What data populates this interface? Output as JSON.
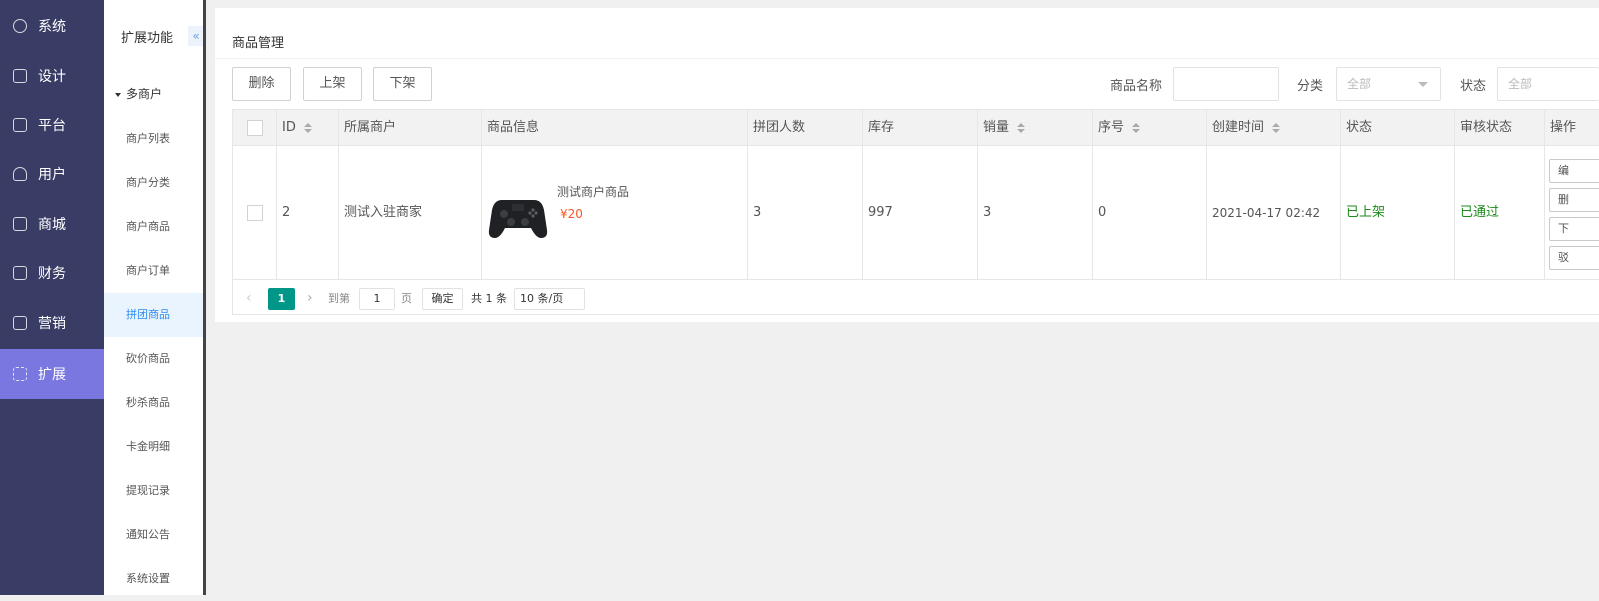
{
  "sidebar_main": {
    "items": [
      {
        "label": "系统",
        "icon": "gear-icon"
      },
      {
        "label": "设计",
        "icon": "design-icon"
      },
      {
        "label": "平台",
        "icon": "platform-icon"
      },
      {
        "label": "用户",
        "icon": "user-icon"
      },
      {
        "label": "商城",
        "icon": "shop-icon"
      },
      {
        "label": "财务",
        "icon": "finance-icon"
      },
      {
        "label": "营销",
        "icon": "gift-icon"
      },
      {
        "label": "扩展",
        "icon": "grid-icon",
        "active": true
      }
    ]
  },
  "sidebar_sub": {
    "title": "扩展功能",
    "collapse_icon": "«",
    "group": "多商户",
    "items": [
      {
        "label": "商户列表"
      },
      {
        "label": "商户分类"
      },
      {
        "label": "商户商品"
      },
      {
        "label": "商户订单"
      },
      {
        "label": "拼团商品",
        "active": true
      },
      {
        "label": "砍价商品"
      },
      {
        "label": "秒杀商品"
      },
      {
        "label": "卡金明细"
      },
      {
        "label": "提现记录"
      },
      {
        "label": "通知公告"
      },
      {
        "label": "系统设置"
      }
    ]
  },
  "page": {
    "title": "商品管理",
    "toolbar": {
      "delete": "删除",
      "on_shelf": "上架",
      "off_shelf": "下架"
    },
    "filters": {
      "name_label": "商品名称",
      "category_label": "分类",
      "category_value": "全部",
      "status_label": "状态",
      "status_value": "全部"
    },
    "table": {
      "headers": [
        "ID",
        "所属商户",
        "商品信息",
        "拼团人数",
        "库存",
        "销量",
        "序号",
        "创建时间",
        "状态",
        "审核状态",
        "操作"
      ],
      "rows": [
        {
          "id": "2",
          "merchant": "测试入驻商家",
          "product_name": "测试商户商品",
          "product_price": "¥20",
          "group_size": "3",
          "stock": "997",
          "sales": "3",
          "order": "0",
          "created": "2021-04-17 02:42",
          "status": "已上架",
          "review": "已通过",
          "ops": [
            "编",
            "删",
            "下",
            "驳"
          ]
        }
      ]
    },
    "pagination": {
      "current": "1",
      "goto_label": "到第",
      "page_input": "1",
      "page_unit": "页",
      "confirm": "确定",
      "total": "共 1 条",
      "page_size": "10 条/页"
    }
  },
  "colors": {
    "sidebar_bg": "#393d66",
    "sidebar_active": "#7a78e0",
    "accent_teal": "#009688",
    "status_green": "#1b8a1b",
    "price_orange": "#ff5722"
  }
}
